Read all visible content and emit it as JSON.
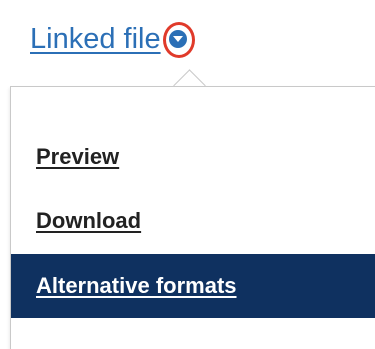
{
  "link": {
    "text": "Linked file",
    "toggle_icon": "chevron-down-icon"
  },
  "menu": {
    "items": [
      {
        "label": "Preview",
        "selected": false
      },
      {
        "label": "Download",
        "selected": false
      },
      {
        "label": "Alternative formats",
        "selected": true
      }
    ]
  },
  "colors": {
    "link": "#2b6fb6",
    "highlight_ring": "#e03a2a",
    "selected_bg": "#0f3160",
    "item_text": "#222222"
  }
}
